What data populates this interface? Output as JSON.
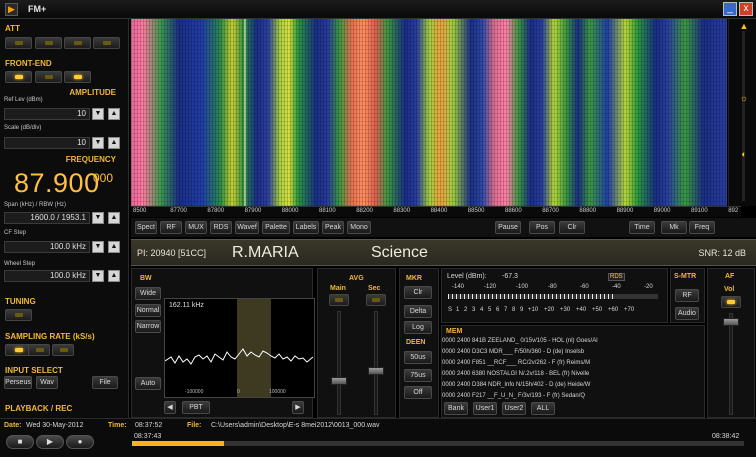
{
  "window": {
    "title": "FM+",
    "min_glyph": "_",
    "close_glyph": "x"
  },
  "left_panel": {
    "att_title": "ATT",
    "frontend_title": "FRONT-END",
    "amplitude_title": "AMPLITUDE",
    "ref_lev_label": "Ref Lev (dBm)",
    "ref_lev_value": "10",
    "scale_label": "Scale (dB/div)",
    "scale_value": "10",
    "frequency_title": "FREQUENCY",
    "frequency_main": "87.900",
    "frequency_sub": "000",
    "span_rbw_label": "Span (kHz) / RBW (Hz)",
    "span_rbw_value": "1600.0 / 1953.1",
    "cf_step_label": "CF Step",
    "cf_step_value": "100.0 kHz",
    "wheel_step_label": "Wheel Step",
    "wheel_step_value": "100.0 kHz",
    "tuning_title": "TUNING",
    "sampling_title": "SAMPLING RATE (kS/s)",
    "input_title": "INPUT SELECT",
    "input_perseus": "Perseus",
    "input_wav": "Wav",
    "input_file": "File",
    "playback_title": "PLAYBACK / REC"
  },
  "freq_scale": [
    "8500",
    "87700",
    "87800",
    "87900",
    "88000",
    "88100",
    "88200",
    "88300",
    "88400",
    "88500",
    "88600",
    "88700",
    "88800",
    "88900",
    "89000",
    "89100",
    "892"
  ],
  "toolbar_left": [
    "Spect",
    "RF",
    "MUX",
    "RDS",
    "Wavef",
    "Palette",
    "Labels",
    "Peak",
    "Mono"
  ],
  "toolbar_right": [
    "Pause",
    "Pos",
    "Clr",
    "Time",
    "Mk",
    "Freq"
  ],
  "rds": {
    "pi": "PI: 20940 [51CC]",
    "ps": "R.MARIA",
    "pty": "Science",
    "snr": "SNR: 12 dB"
  },
  "bw": {
    "title": "BW",
    "value": "162.11 kHz",
    "buttons": [
      "Wide",
      "Normal",
      "Narrow"
    ],
    "auto": "Auto",
    "pbt": "PBT",
    "ticks": [
      "-100000",
      "0",
      "100000"
    ]
  },
  "avg": {
    "title": "AVG",
    "main": "Main",
    "sec": "Sec"
  },
  "mkr": {
    "title": "MKR",
    "buttons": [
      "Clr",
      "Delta",
      "Log"
    ]
  },
  "deen": {
    "title": "DEEN",
    "buttons": [
      "50us",
      "75us",
      "Off"
    ]
  },
  "level": {
    "label": "Level (dBm):",
    "value": "-67.3",
    "rds_badge": "RDS",
    "scale_dbm": [
      "-140",
      "-120",
      "-100",
      "-80",
      "-60",
      "-40",
      "-20"
    ],
    "scale_s": [
      "S",
      "1",
      "2",
      "3",
      "4",
      "5",
      "6",
      "7",
      "8",
      "9",
      "+10",
      "+20",
      "+30",
      "+40",
      "+50",
      "+60",
      "+70"
    ],
    "fill_fraction": 0.8
  },
  "smtr": {
    "title": "S-MTR",
    "buttons": [
      "RF",
      "Audio"
    ]
  },
  "af": {
    "title": "AF",
    "vol": "Vol"
  },
  "mem": {
    "title": "MEM",
    "lines": [
      "0000 2400 841B ZEELAND_ 0/15v/105 - HOL (nl)  Goes/Al",
      "0000 2400 D3C3 MDR___ F/50h/360 - D (de)  Inselsb",
      "0000 2400 F851 __RCF___ RC/2v/262 - F (fr)  Reims/M",
      "0000 2400 6380 NOSTALGI N/.2v/118 - BEL (fr)  Nivelle",
      "0000 2400 D384 NDR_Info N/15h/402 - D (de)  Heide/W",
      "0000 2400 F217 __F_U_N_ F/3v/193 - F (fr)  Sedan/Q"
    ],
    "buttons": [
      "Bank",
      "User1",
      "User2",
      "ALL"
    ]
  },
  "status": {
    "date_label": "Date:",
    "date_value": "Wed 30-May-2012",
    "time_label": "Time:",
    "time_value": "08:37:52",
    "file_label": "File:",
    "file_value": "C:\\Users\\admin\\Desktop\\E-s 8mei2012\\0013_000.wav",
    "pos_start": "08:37:43",
    "pos_end": "08:38:42",
    "progress_fraction": 0.15
  }
}
